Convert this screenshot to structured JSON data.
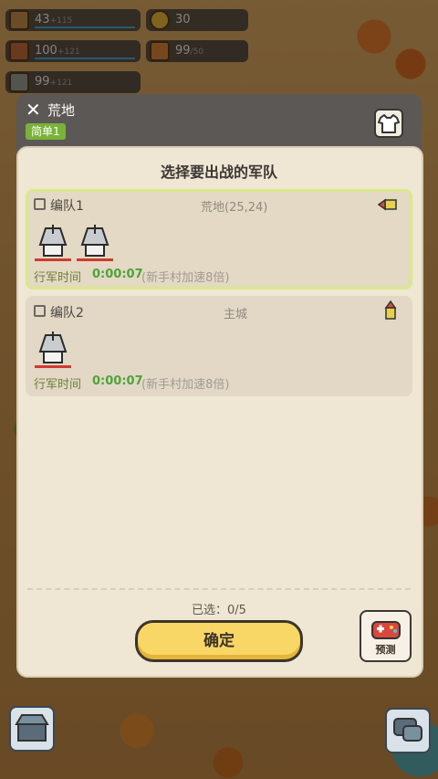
{
  "resources": [
    {
      "name": "wood",
      "value": "43",
      "cap": "+115",
      "color": "#c48a4a"
    },
    {
      "name": "coin",
      "value": "30",
      "cap": "",
      "color": "#e6b53c"
    },
    {
      "name": "meat",
      "value": "100",
      "cap": "+121",
      "color": "#c06a3a"
    },
    {
      "name": "gift",
      "value": "99",
      "cap": "/50",
      "color": "#d8823a"
    },
    {
      "name": "stone",
      "value": "99",
      "cap": "+121",
      "color": "#9a9a90"
    }
  ],
  "header": {
    "title": "荒地",
    "difficulty": "简单1"
  },
  "panel": {
    "title": "选择要出战的军队",
    "selected_count": "已选：0/5",
    "confirm_label": "确定",
    "predict_label": "预测"
  },
  "squads": [
    {
      "name": "编队1",
      "destination": "荒地(25,24)",
      "march_label": "行军时间",
      "march_time": "0:00:07",
      "march_note": "(新手村加速8倍)"
    },
    {
      "name": "编队2",
      "destination": "主城",
      "march_label": "行军时间",
      "march_time": "0:00:07",
      "march_note": "(新手村加速8倍)"
    }
  ],
  "icons": {
    "close": "close-icon",
    "shirt": "shirt-icon",
    "predict": "game-predict-icon",
    "unit": "knight-helmet-icon"
  }
}
